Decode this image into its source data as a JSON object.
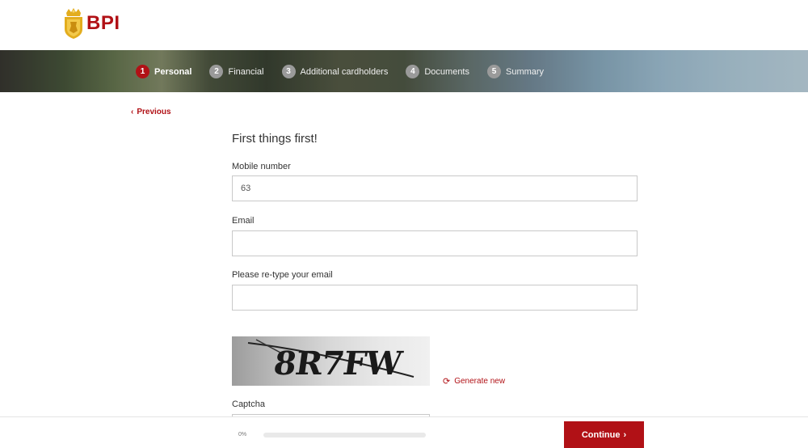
{
  "brand": {
    "name": "BPI",
    "accent_color": "#b11116",
    "logo_icon": "crown-lion-shield-icon"
  },
  "steps": [
    {
      "num": "1",
      "label": "Personal",
      "active": true
    },
    {
      "num": "2",
      "label": "Financial",
      "active": false
    },
    {
      "num": "3",
      "label": "Additional cardholders",
      "active": false
    },
    {
      "num": "4",
      "label": "Documents",
      "active": false
    },
    {
      "num": "5",
      "label": "Summary",
      "active": false
    }
  ],
  "nav": {
    "previous_label": "Previous"
  },
  "form": {
    "title": "First things first!",
    "mobile": {
      "label": "Mobile number",
      "value": "63"
    },
    "email": {
      "label": "Email",
      "value": ""
    },
    "email_confirm": {
      "label": "Please re-type your email",
      "value": ""
    },
    "captcha": {
      "image_text": "8R7FW",
      "generate_label": "Generate new",
      "label": "Captcha",
      "value": ""
    }
  },
  "footer": {
    "progress_text": "0%",
    "progress_value": 0,
    "continue_label": "Continue"
  }
}
